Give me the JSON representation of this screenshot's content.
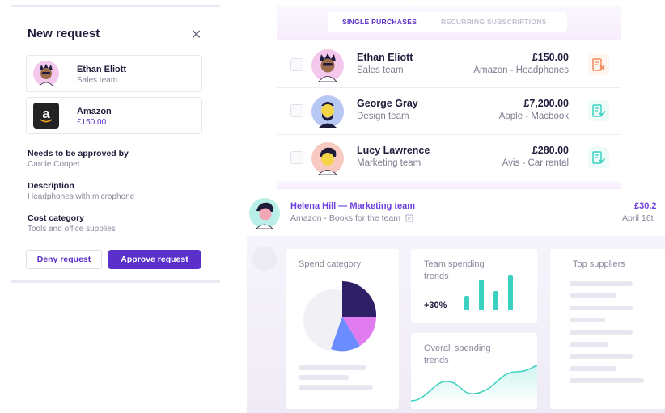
{
  "request_panel": {
    "title": "New request",
    "close_icon": "close-icon",
    "requester": {
      "name": "Ethan Eliott",
      "team": "Sales team"
    },
    "vendor": {
      "name": "Amazon",
      "amount": "£150.00",
      "logo_letter": "a"
    },
    "approver": {
      "label": "Needs to be approved by",
      "value": "Carole Cooper"
    },
    "description": {
      "label": "Description",
      "value": "Headphones with microphone"
    },
    "cost_category": {
      "label": "Cost category",
      "value": "Tools and office supplies"
    },
    "deny_label": "Deny request",
    "approve_label": "Approve request"
  },
  "tabs": [
    {
      "label": "SINGLE PURCHASES",
      "active": true
    },
    {
      "label": "RECURRING SUBSCRIPTIONS",
      "active": false
    }
  ],
  "requests": [
    {
      "name": "Ethan Eliott",
      "team": "Sales team",
      "amount": "£150.00",
      "detail": "Amazon - Headphones",
      "status": "denied",
      "status_icon": "receipt-x-icon"
    },
    {
      "name": "George Gray",
      "team": "Design team",
      "amount": "£7,200.00",
      "detail": "Apple - Macbook",
      "status": "approved",
      "status_icon": "receipt-check-icon"
    },
    {
      "name": "Lucy Lawrence",
      "team": "Marketing team",
      "amount": "£280.00",
      "detail": "Avis - Car rental",
      "status": "approved",
      "status_icon": "receipt-check-icon"
    }
  ],
  "highlighted_request": {
    "title": "Helena Hill — Marketing team",
    "detail": "Amazon - Books for the team",
    "amount": "£30.2",
    "date": "April 16t"
  },
  "dashboard": {
    "spend_category": {
      "title": "Spend category"
    },
    "team_trends": {
      "title": "Team spending trends",
      "change": "+30%"
    },
    "overall_trends": {
      "title": "Overall spending trends"
    },
    "top_suppliers": {
      "title": "Top suppliers"
    }
  },
  "colors": {
    "accent": "#5b2fc9",
    "accent_light": "#6c3fe0",
    "denied": "#f08a5d",
    "approved": "#3ad1c1",
    "pie_dark": "#2e1f66",
    "pie_pink": "#e07cf0",
    "pie_blue": "#6a8cff"
  }
}
